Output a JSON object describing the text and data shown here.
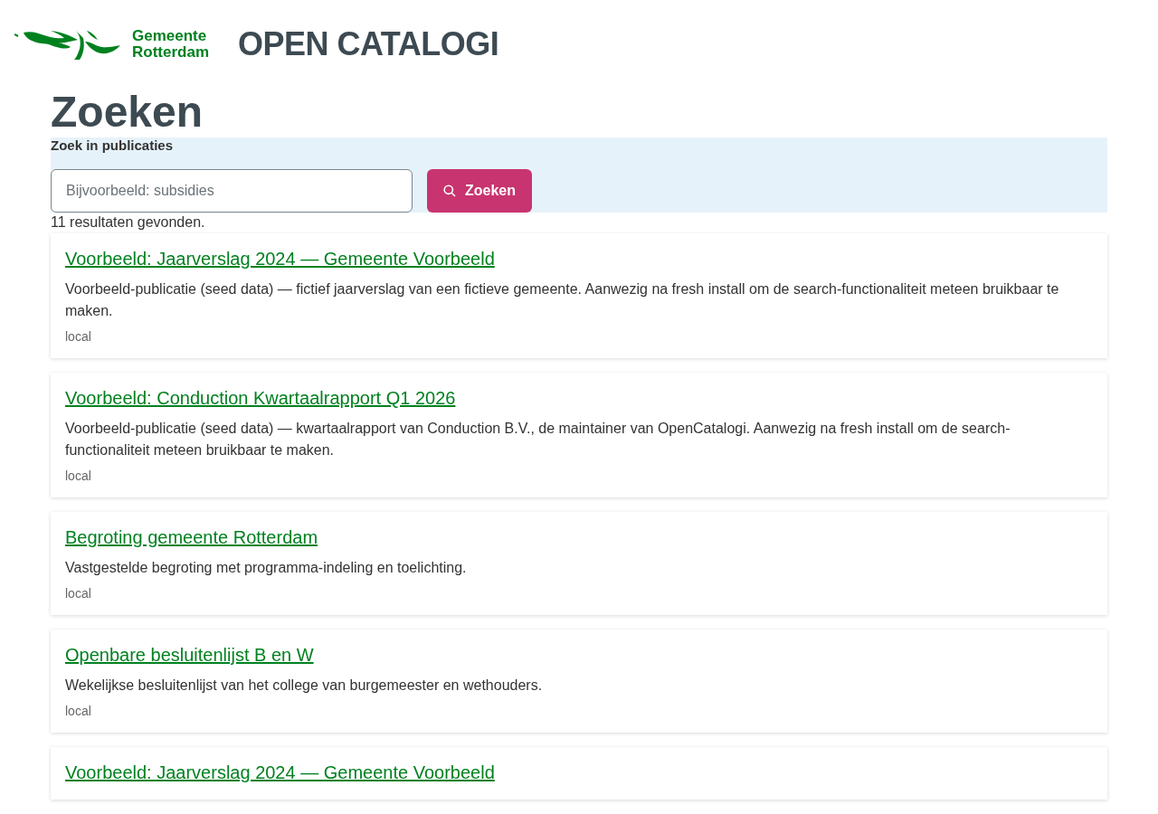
{
  "header": {
    "logo_text": [
      "Gemeente",
      "Rotterdam"
    ],
    "site_title": "OPEN CATALOGI"
  },
  "page_title": "Zoeken",
  "search": {
    "label": "Zoek in publicaties",
    "placeholder": "Bijvoorbeeld: subsidies",
    "button": "Zoeken"
  },
  "result_count": "11 resultaten gevonden.",
  "results": [
    {
      "title": "Voorbeeld: Jaarverslag 2024 — Gemeente Voorbeeld",
      "description": "Voorbeeld-publicatie (seed data) — fictief jaarverslag van een fictieve gemeente. Aanwezig na fresh install om de search-functionaliteit meteen bruikbaar te maken.",
      "source": "local"
    },
    {
      "title": "Voorbeeld: Conduction Kwartaalrapport Q1 2026",
      "description": "Voorbeeld-publicatie (seed data) — kwartaalrapport van Conduction B.V., de maintainer van OpenCatalogi. Aanwezig na fresh install om de search-functionaliteit meteen bruikbaar te maken.",
      "source": "local"
    },
    {
      "title": "Begroting gemeente Rotterdam",
      "description": "Vastgestelde begroting met programma-indeling en toelichting.",
      "source": "local"
    },
    {
      "title": "Openbare besluitenlijst B en W",
      "description": "Wekelijkse besluitenlijst van het college van burgemeester en wethouders.",
      "source": "local"
    },
    {
      "title": "Voorbeeld: Jaarverslag 2024 — Gemeente Voorbeeld"
    }
  ]
}
